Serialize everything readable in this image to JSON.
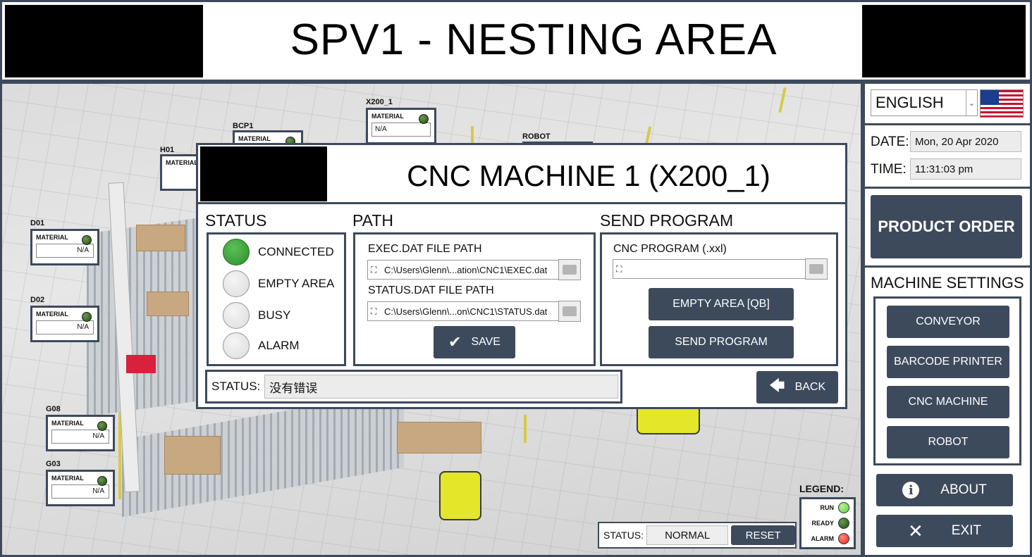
{
  "header": {
    "title": "SPV1 - NESTING AREA"
  },
  "scene": {
    "machines": [
      {
        "tag": "X200_1",
        "label": "MATERIAL",
        "value": "N/A"
      },
      {
        "tag": "BCP1",
        "label": "MATERIAL",
        "value": ""
      },
      {
        "tag": "H01",
        "label": "MATERIAL",
        "value": ""
      },
      {
        "tag": "ROBOT",
        "label": "",
        "value": ""
      },
      {
        "tag": "D01",
        "label": "MATERIAL",
        "value": "N/A"
      },
      {
        "tag": "D02",
        "label": "MATERIAL",
        "value": "N/A"
      },
      {
        "tag": "G08",
        "label": "MATERIAL",
        "value": "N/A"
      },
      {
        "tag": "G03",
        "label": "MATERIAL",
        "value": "N/A"
      }
    ]
  },
  "modal": {
    "title": "CNC MACHINE 1 (X200_1)",
    "status_section": "STATUS",
    "status_items": [
      {
        "label": "CONNECTED",
        "active": true
      },
      {
        "label": "EMPTY AREA",
        "active": false
      },
      {
        "label": "BUSY",
        "active": false
      },
      {
        "label": "ALARM",
        "active": false
      }
    ],
    "path_section": "PATH",
    "exec_label": "EXEC.DAT FILE PATH",
    "exec_value": "C:\\Users\\Glenn\\...ation\\CNC1\\EXEC.dat",
    "status_file_label": "STATUS.DAT FILE PATH",
    "status_file_value": "C:\\Users\\Glenn\\...on\\CNC1\\STATUS.dat",
    "save_label": "SAVE",
    "send_section": "SEND PROGRAM",
    "cnc_program_label": "CNC PROGRAM (.xxl)",
    "cnc_program_value": "",
    "empty_area_label": "EMPTY AREA [QB]",
    "send_program_label": "SEND PROGRAM",
    "status_label": "STATUS:",
    "status_value": "没有错误",
    "back_label": "BACK"
  },
  "sidebar": {
    "language": "ENGLISH",
    "date_label": "DATE:",
    "date_value": "Mon, 20 Apr 2020",
    "time_label": "TIME:",
    "time_value": "11:31:03 pm",
    "product_order_label": "PRODUCT ORDER",
    "machine_settings_title": "MACHINE SETTINGS",
    "machine_settings": [
      "CONVEYOR",
      "BARCODE PRINTER",
      "CNC MACHINE",
      "ROBOT"
    ],
    "about_label": "ABOUT",
    "exit_label": "EXIT"
  },
  "footer": {
    "status_label": "STATUS:",
    "status_value": "NORMAL",
    "reset_label": "RESET",
    "legend_title": "LEGEND:",
    "legend": [
      {
        "label": "RUN",
        "color": "#5fd03f"
      },
      {
        "label": "READY",
        "color": "#2f6a1e"
      },
      {
        "label": "ALARM",
        "color": "#e8221c"
      }
    ]
  },
  "colors": {
    "panel_border": "#3d4a5c",
    "button_bg": "#3d4a5c",
    "connected_green": "#2c8e2a"
  }
}
